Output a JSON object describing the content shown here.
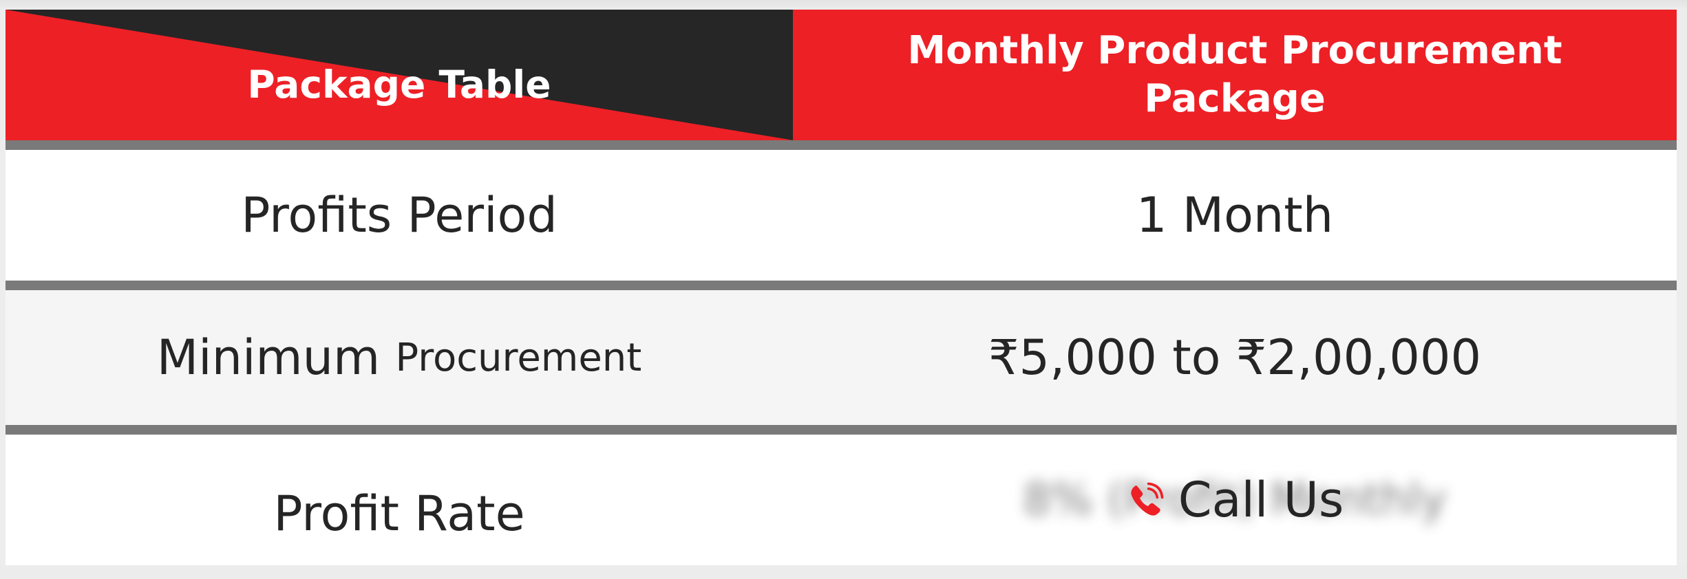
{
  "header": {
    "left_label": "Package Table",
    "right_label": "Monthly Product Procurement Package"
  },
  "rows": [
    {
      "label": "Profits Period",
      "value": "1 Month"
    },
    {
      "label_main": "Minimum",
      "label_small": "Procurement",
      "value": "₹5,000 to ₹2,00,000"
    },
    {
      "label": "Profit Rate",
      "blurred_value": "8% (Profit) Monthly",
      "call_label": "Call Us"
    }
  ],
  "colors": {
    "accent_red": "#ed2026",
    "dark": "#262626",
    "divider": "#7a7a7a",
    "alt_row": "#f4f5f4",
    "text": "#252525"
  },
  "icons": {
    "call": "phone-icon"
  }
}
